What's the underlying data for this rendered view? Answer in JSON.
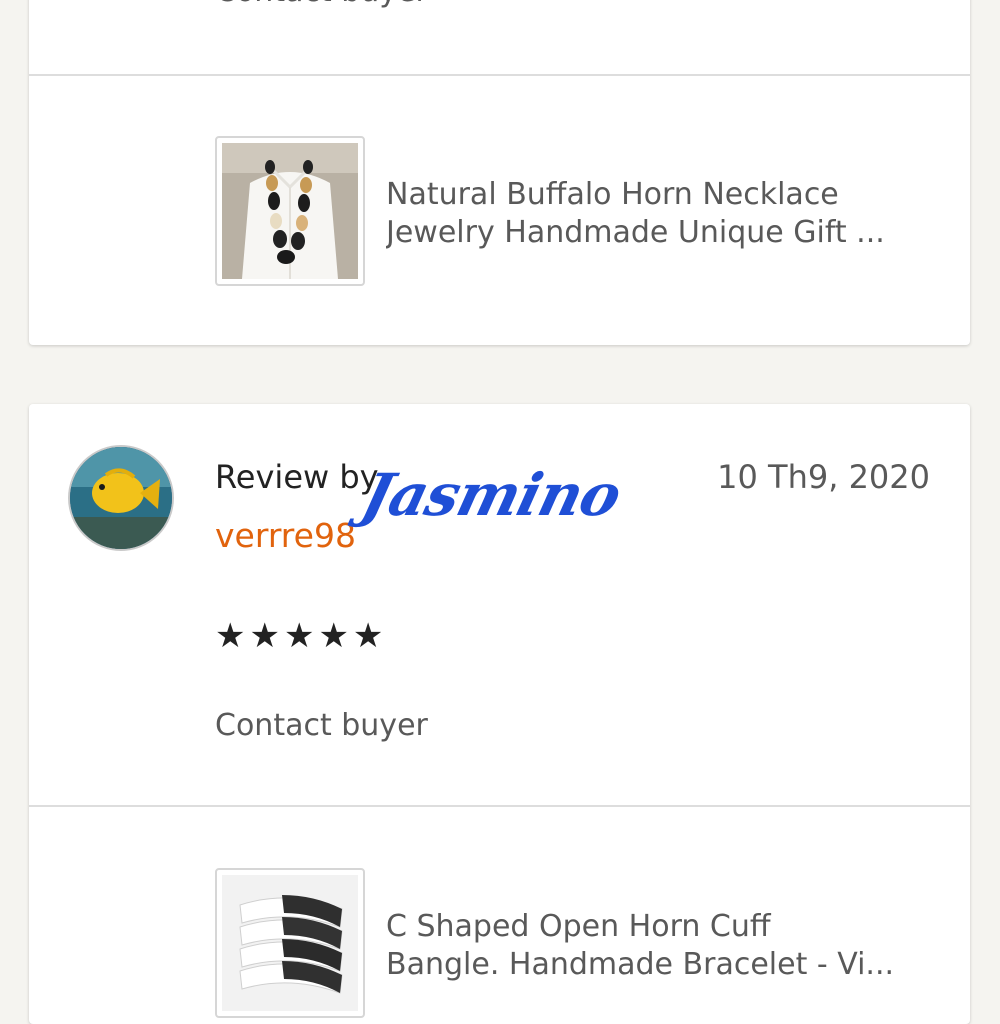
{
  "review_1": {
    "contact_label": "Contact buyer",
    "listing": {
      "title_line1": "Natural Buffalo Horn Necklace",
      "title_line2": "Jewelry Handmade Unique Gift ..."
    }
  },
  "review_2": {
    "review_by_label": "Review by",
    "reviewer_name": "verrre98",
    "date": "10 Th9, 2020",
    "stars": "★★★★★",
    "rating": 5,
    "rating_max": 5,
    "contact_label": "Contact buyer",
    "listing": {
      "title_line1": "C Shaped Open Horn Cuff",
      "title_line2": "Bangle. Handmade Bracelet - Vi..."
    }
  },
  "watermark_signature": "Jasmino",
  "colors": {
    "background": "#f5f4f0",
    "card": "#ffffff",
    "reviewer_name": "#e1630d",
    "secondary_text": "#595959",
    "signature": "#1f4fd6"
  },
  "icons": {
    "avatar": "yellow-fish-avatar",
    "stars": "star-icon"
  }
}
